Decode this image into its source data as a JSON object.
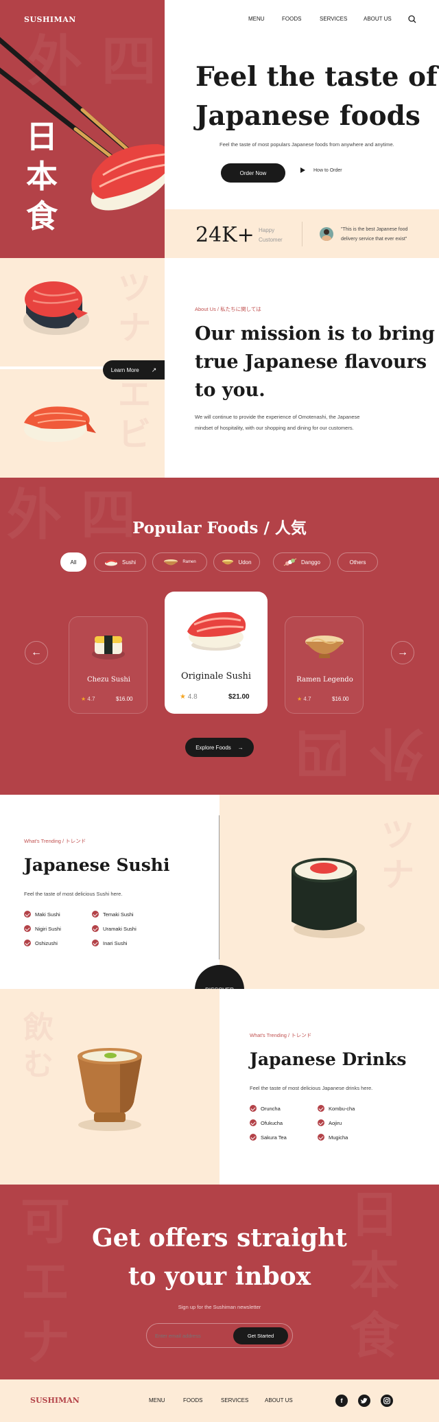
{
  "brand": {
    "name": "SUSHIMAN"
  },
  "nav": {
    "items": [
      "MENU",
      "FOODS",
      "SERVICES",
      "ABOUT US"
    ]
  },
  "hero": {
    "kanji": [
      "日",
      "本",
      "食"
    ],
    "title_line1": "Feel the taste of",
    "title_line2": "Japanese foods",
    "subtitle": "Feel the taste of most populars Japanese foods from anywhere and anytime.",
    "order_button": "Order Now",
    "how_button": "How to Order"
  },
  "stats": {
    "count": "24K+",
    "label_line1": "Happy",
    "label_line2": "Customer",
    "quote_line1": "\"This is the best Japanese food",
    "quote_line2": "delivery service that ever exist\""
  },
  "about": {
    "eyebrow": "About Us / 私たちに関しては",
    "title_line1": "Our mission is to bring",
    "title_line2": "true Japanese flavours",
    "title_line3": "to you.",
    "body_line1": "We will continue to provide the experience of Omotenashi, the Japanese",
    "body_line2": "mindset of hospitality, with our shopping and dining for our customers.",
    "learn_more": "Learn More",
    "ghost_kana": [
      "ツ",
      "ナ",
      "エ",
      "ビ"
    ]
  },
  "popular": {
    "title": "Popular Foods / 人気",
    "filters": [
      "All",
      "Sushi",
      "Ramen",
      "Udon",
      "Danggo",
      "Others"
    ],
    "cards": [
      {
        "name": "Chezu Sushi",
        "rating": "4.7",
        "price": "$16.00"
      },
      {
        "name": "Originale Sushi",
        "rating": "4.8",
        "price": "$21.00"
      },
      {
        "name": "Ramen Legendo",
        "rating": "4.7",
        "price": "$16.00"
      }
    ],
    "explore": "Explore Foods"
  },
  "trending_sushi": {
    "eyebrow": "What's Trending / トレンド",
    "title": "Japanese Sushi",
    "subtitle": "Feel the taste of most delicious Sushi here.",
    "items": [
      "Maki Sushi",
      "Temaki Sushi",
      "Nigiri Sushi",
      "Uramaki Sushi",
      "Oshizushi",
      "Inari Sushi"
    ],
    "ghost_kana": [
      "ツ",
      "ナ"
    ]
  },
  "discover": {
    "label": "DISCOVER"
  },
  "trending_drinks": {
    "eyebrow": "What's Trending / トレンド",
    "title": "Japanese Drinks",
    "subtitle": "Feel the taste of most delicious Japanese drinks here.",
    "items": [
      "Oruncha",
      "Kombu-cha",
      "Ofukucha",
      "Aojiru",
      "Sakura Tea",
      "Mugicha"
    ],
    "ghost_kana": [
      "飲",
      "む"
    ]
  },
  "newsletter": {
    "title_line1": "Get offers straight",
    "title_line2": "to your inbox",
    "subtitle": "Sign up for the Sushiman newsletter",
    "placeholder": "Enter email address",
    "button": "Get Started"
  },
  "footer": {
    "brand": "SUSHIMAN",
    "links": [
      "MENU",
      "FOODS",
      "SERVICES",
      "ABOUT US"
    ],
    "social": [
      "facebook-icon",
      "twitter-icon",
      "instagram-icon"
    ]
  },
  "colors": {
    "primary": "#b34248",
    "cream": "#fdebd7",
    "dark": "#1a1a1a",
    "star": "#f4a623"
  }
}
